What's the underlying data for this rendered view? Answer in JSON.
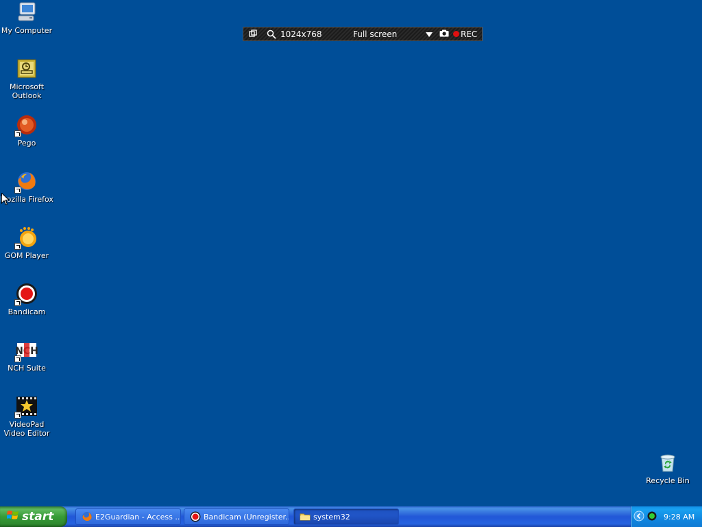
{
  "desktop": {
    "icons": [
      {
        "label": "My Computer"
      },
      {
        "label": "Microsoft Outlook"
      },
      {
        "label": "Pego"
      },
      {
        "label": "Mozilla Firefox"
      },
      {
        "label": "GOM Player"
      },
      {
        "label": "Bandicam"
      },
      {
        "label": "NCH Suite"
      },
      {
        "label": "VideoPad Video Editor"
      },
      {
        "label": "Recycle Bin"
      }
    ],
    "background_color": "#004e98"
  },
  "recorder": {
    "resolution": "1024x768",
    "mode": "Full screen",
    "rec_label": "REC",
    "rec_color": "#e01010"
  },
  "taskbar": {
    "start_label": "start",
    "buttons": [
      {
        "label": "E2Guardian - Access ...",
        "icon": "firefox-icon"
      },
      {
        "label": "Bandicam (Unregister...",
        "icon": "bandicam-icon"
      },
      {
        "label": "system32",
        "icon": "folder-icon"
      }
    ],
    "clock": "9:28 AM"
  }
}
